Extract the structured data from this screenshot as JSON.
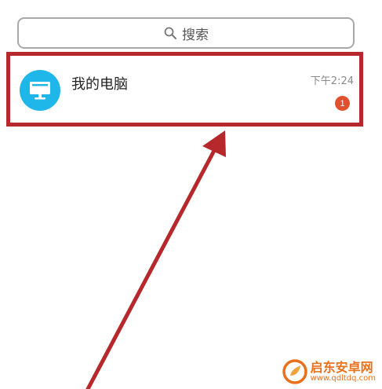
{
  "search": {
    "label": "搜索",
    "icon": "search-icon"
  },
  "chat_item": {
    "name": "我的电脑",
    "time": "下午2:24",
    "unread_count": "1",
    "avatar_icon": "computer-monitor-icon",
    "avatar_color": "#1fb7ea",
    "highlight_color": "#b6282b",
    "badge_color": "#e2512f"
  },
  "annotation": {
    "arrow_color": "#b6282b"
  },
  "watermark": {
    "title": "启东安卓网",
    "url": "www.qdltdq.com",
    "color": "#e8711d"
  }
}
